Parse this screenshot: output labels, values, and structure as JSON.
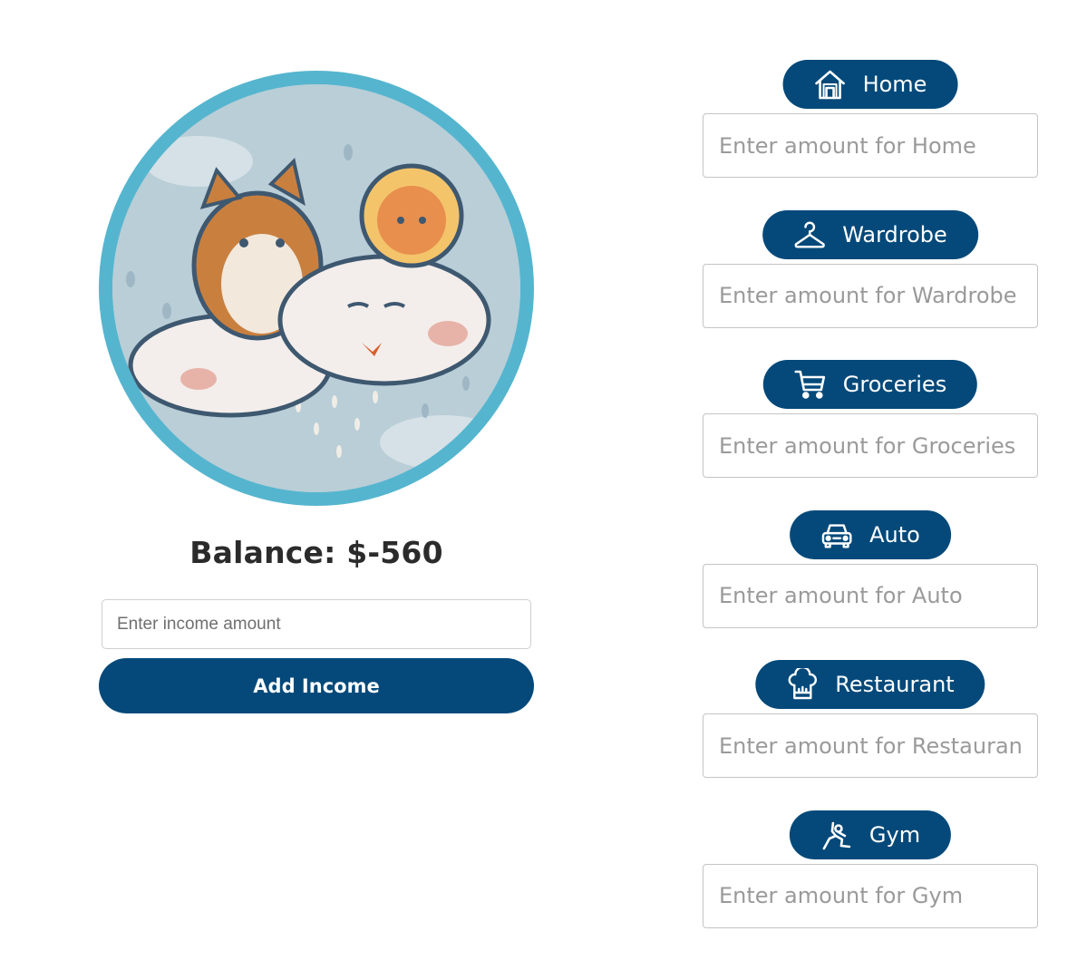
{
  "balance": {
    "text": "Balance: $-560"
  },
  "income": {
    "placeholder": "Enter income amount",
    "button_label": "Add Income"
  },
  "colors": {
    "primary": "#04497a",
    "avatar_ring": "#55b5cf"
  },
  "avatar": {
    "icon": "avatar-illustration"
  },
  "categories": [
    {
      "label": "Home",
      "icon": "home-icon",
      "placeholder": "Enter amount for Home"
    },
    {
      "label": "Wardrobe",
      "icon": "hanger-icon",
      "placeholder": "Enter amount for Wardrobe"
    },
    {
      "label": "Groceries",
      "icon": "cart-icon",
      "placeholder": "Enter amount for Groceries"
    },
    {
      "label": "Auto",
      "icon": "car-icon",
      "placeholder": "Enter amount for Auto"
    },
    {
      "label": "Restaurant",
      "icon": "chef-hat-icon",
      "placeholder": "Enter amount for Restaurant"
    },
    {
      "label": "Gym",
      "icon": "fitness-icon",
      "placeholder": "Enter amount for Gym"
    }
  ]
}
